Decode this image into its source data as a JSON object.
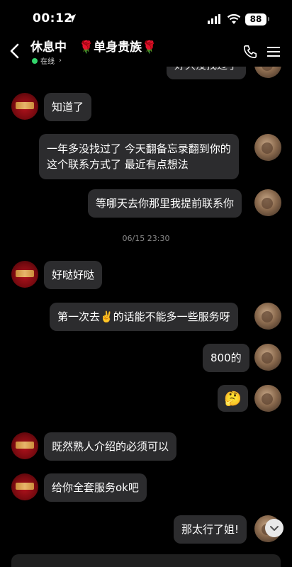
{
  "status_bar": {
    "time": "00:12",
    "battery": "88"
  },
  "header": {
    "title": "休息中　🌹单身贵族🌹",
    "status": "在线",
    "status_chevron": "›"
  },
  "messages": [
    {
      "side": "right",
      "text": "好久没找过了",
      "partial": true
    },
    {
      "side": "left",
      "text": "知道了"
    },
    {
      "side": "right",
      "lines": [
        "一年多没找过了 今天翻备忘录翻到你的",
        "这个联系方式了 最近有点想法"
      ]
    },
    {
      "side": "right",
      "text": "等哪天去你那里我提前联系你"
    },
    {
      "timestamp": "06/15 23:30"
    },
    {
      "side": "left",
      "text": "好哒好哒"
    },
    {
      "side": "right",
      "text": "第一次去✌️的话能不能多一些服务呀"
    },
    {
      "side": "right",
      "text": "800的"
    },
    {
      "side": "right",
      "text": "🤔"
    },
    {
      "side": "left",
      "text": "既然熟人介绍的必须可以"
    },
    {
      "side": "left",
      "text": "给你全套服务ok吧"
    },
    {
      "side": "right",
      "text": "那太行了姐!"
    }
  ],
  "icons": {
    "back": "back-chevron-icon",
    "call": "phone-icon",
    "menu": "menu-icon",
    "scroll": "chevron-down-icon"
  }
}
